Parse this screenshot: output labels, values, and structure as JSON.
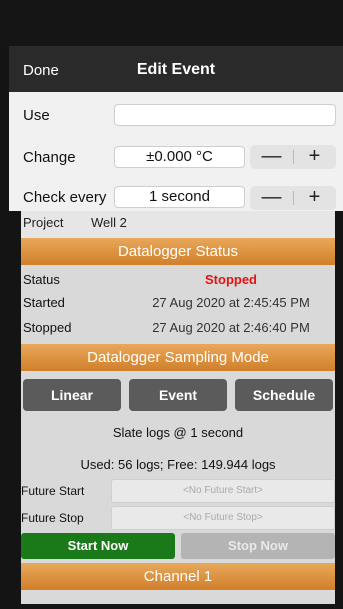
{
  "modal": {
    "done_label": "Done",
    "title": "Edit Event",
    "rows": {
      "use": {
        "label": "Use",
        "value": ""
      },
      "change": {
        "label": "Change",
        "value": "±0.000 °C",
        "minus": "—",
        "plus": "+"
      },
      "check_every": {
        "label": "Check every",
        "value": "1 second",
        "minus": "—",
        "plus": "+"
      }
    }
  },
  "background": {
    "project": {
      "label": "Project",
      "value": "Well 2"
    },
    "status_section": {
      "header": "Datalogger Status",
      "status_label": "Status",
      "status_value": "Stopped",
      "started_label": "Started",
      "started_value": "27 Aug 2020 at 2:45:45 PM",
      "stopped_label": "Stopped",
      "stopped_value": "27 Aug 2020 at 2:46:40 PM"
    },
    "sampling_section": {
      "header": "Datalogger Sampling Mode",
      "modes": [
        "Linear",
        "Event",
        "Schedule"
      ],
      "slate_text": "Slate logs @ 1 second",
      "usage_text": "Used: 56 logs; Free: 149.944 logs",
      "future_start_label": "Future Start",
      "future_start_placeholder": "<No Future Start>",
      "future_stop_label": "Future Stop",
      "future_stop_placeholder": "<No Future Stop>",
      "start_now": "Start Now",
      "stop_now": "Stop Now"
    },
    "channel_header": "Channel 1"
  },
  "colors": {
    "section_orange": "#d9893a",
    "status_stopped": "#e01414",
    "start_green": "#1a7a1a",
    "mode_button": "#5b5b5b"
  }
}
